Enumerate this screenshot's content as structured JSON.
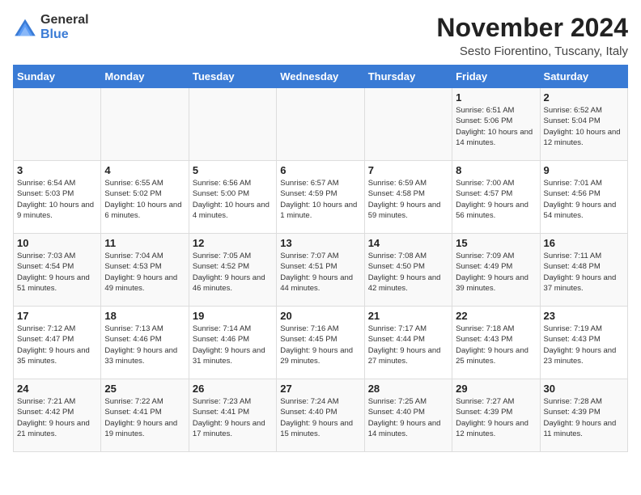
{
  "header": {
    "logo_general": "General",
    "logo_blue": "Blue",
    "month": "November 2024",
    "location": "Sesto Fiorentino, Tuscany, Italy"
  },
  "days_of_week": [
    "Sunday",
    "Monday",
    "Tuesday",
    "Wednesday",
    "Thursday",
    "Friday",
    "Saturday"
  ],
  "weeks": [
    [
      {
        "day": "",
        "info": ""
      },
      {
        "day": "",
        "info": ""
      },
      {
        "day": "",
        "info": ""
      },
      {
        "day": "",
        "info": ""
      },
      {
        "day": "",
        "info": ""
      },
      {
        "day": "1",
        "info": "Sunrise: 6:51 AM\nSunset: 5:06 PM\nDaylight: 10 hours and 14 minutes."
      },
      {
        "day": "2",
        "info": "Sunrise: 6:52 AM\nSunset: 5:04 PM\nDaylight: 10 hours and 12 minutes."
      }
    ],
    [
      {
        "day": "3",
        "info": "Sunrise: 6:54 AM\nSunset: 5:03 PM\nDaylight: 10 hours and 9 minutes."
      },
      {
        "day": "4",
        "info": "Sunrise: 6:55 AM\nSunset: 5:02 PM\nDaylight: 10 hours and 6 minutes."
      },
      {
        "day": "5",
        "info": "Sunrise: 6:56 AM\nSunset: 5:00 PM\nDaylight: 10 hours and 4 minutes."
      },
      {
        "day": "6",
        "info": "Sunrise: 6:57 AM\nSunset: 4:59 PM\nDaylight: 10 hours and 1 minute."
      },
      {
        "day": "7",
        "info": "Sunrise: 6:59 AM\nSunset: 4:58 PM\nDaylight: 9 hours and 59 minutes."
      },
      {
        "day": "8",
        "info": "Sunrise: 7:00 AM\nSunset: 4:57 PM\nDaylight: 9 hours and 56 minutes."
      },
      {
        "day": "9",
        "info": "Sunrise: 7:01 AM\nSunset: 4:56 PM\nDaylight: 9 hours and 54 minutes."
      }
    ],
    [
      {
        "day": "10",
        "info": "Sunrise: 7:03 AM\nSunset: 4:54 PM\nDaylight: 9 hours and 51 minutes."
      },
      {
        "day": "11",
        "info": "Sunrise: 7:04 AM\nSunset: 4:53 PM\nDaylight: 9 hours and 49 minutes."
      },
      {
        "day": "12",
        "info": "Sunrise: 7:05 AM\nSunset: 4:52 PM\nDaylight: 9 hours and 46 minutes."
      },
      {
        "day": "13",
        "info": "Sunrise: 7:07 AM\nSunset: 4:51 PM\nDaylight: 9 hours and 44 minutes."
      },
      {
        "day": "14",
        "info": "Sunrise: 7:08 AM\nSunset: 4:50 PM\nDaylight: 9 hours and 42 minutes."
      },
      {
        "day": "15",
        "info": "Sunrise: 7:09 AM\nSunset: 4:49 PM\nDaylight: 9 hours and 39 minutes."
      },
      {
        "day": "16",
        "info": "Sunrise: 7:11 AM\nSunset: 4:48 PM\nDaylight: 9 hours and 37 minutes."
      }
    ],
    [
      {
        "day": "17",
        "info": "Sunrise: 7:12 AM\nSunset: 4:47 PM\nDaylight: 9 hours and 35 minutes."
      },
      {
        "day": "18",
        "info": "Sunrise: 7:13 AM\nSunset: 4:46 PM\nDaylight: 9 hours and 33 minutes."
      },
      {
        "day": "19",
        "info": "Sunrise: 7:14 AM\nSunset: 4:46 PM\nDaylight: 9 hours and 31 minutes."
      },
      {
        "day": "20",
        "info": "Sunrise: 7:16 AM\nSunset: 4:45 PM\nDaylight: 9 hours and 29 minutes."
      },
      {
        "day": "21",
        "info": "Sunrise: 7:17 AM\nSunset: 4:44 PM\nDaylight: 9 hours and 27 minutes."
      },
      {
        "day": "22",
        "info": "Sunrise: 7:18 AM\nSunset: 4:43 PM\nDaylight: 9 hours and 25 minutes."
      },
      {
        "day": "23",
        "info": "Sunrise: 7:19 AM\nSunset: 4:43 PM\nDaylight: 9 hours and 23 minutes."
      }
    ],
    [
      {
        "day": "24",
        "info": "Sunrise: 7:21 AM\nSunset: 4:42 PM\nDaylight: 9 hours and 21 minutes."
      },
      {
        "day": "25",
        "info": "Sunrise: 7:22 AM\nSunset: 4:41 PM\nDaylight: 9 hours and 19 minutes."
      },
      {
        "day": "26",
        "info": "Sunrise: 7:23 AM\nSunset: 4:41 PM\nDaylight: 9 hours and 17 minutes."
      },
      {
        "day": "27",
        "info": "Sunrise: 7:24 AM\nSunset: 4:40 PM\nDaylight: 9 hours and 15 minutes."
      },
      {
        "day": "28",
        "info": "Sunrise: 7:25 AM\nSunset: 4:40 PM\nDaylight: 9 hours and 14 minutes."
      },
      {
        "day": "29",
        "info": "Sunrise: 7:27 AM\nSunset: 4:39 PM\nDaylight: 9 hours and 12 minutes."
      },
      {
        "day": "30",
        "info": "Sunrise: 7:28 AM\nSunset: 4:39 PM\nDaylight: 9 hours and 11 minutes."
      }
    ]
  ]
}
